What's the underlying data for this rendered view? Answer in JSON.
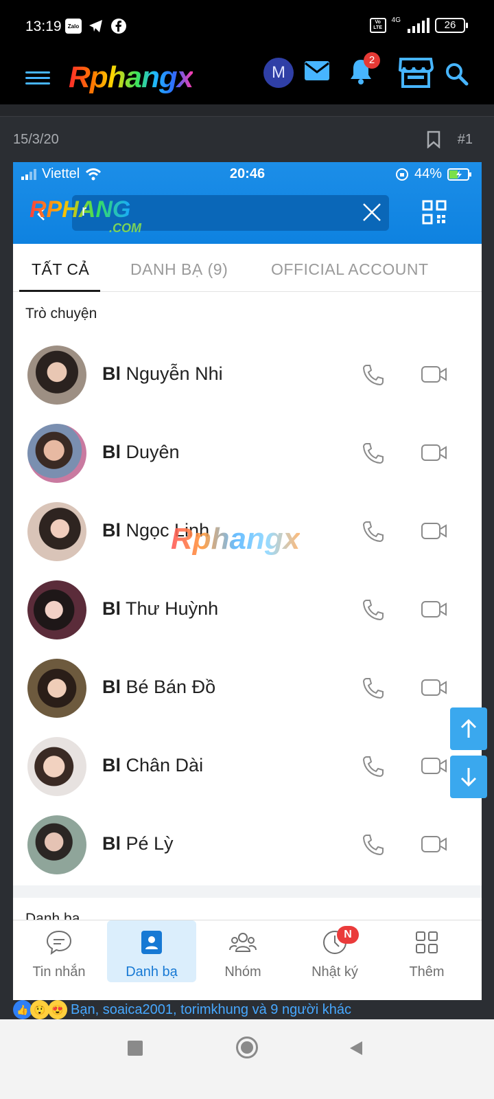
{
  "status_bar": {
    "time": "13:19",
    "zalo_label": "Zalo",
    "volte": "Vo LTE",
    "network": "4G",
    "battery": "26"
  },
  "app_bar": {
    "logo": "Rphangx",
    "avatar_letter": "M",
    "notification_count": "2"
  },
  "post": {
    "date": "15/3/20",
    "post_number": "#1"
  },
  "screenshot": {
    "status": {
      "carrier": "Viettel",
      "time": "20:46",
      "battery": "44%"
    },
    "search": {
      "watermark": "RPHANG",
      "watermark_sub": ".COM",
      "query": "r"
    },
    "tabs": [
      {
        "label": "TẤT CẢ",
        "active": true
      },
      {
        "label": "DANH BẠ (9)",
        "active": false
      },
      {
        "label": "OFFICIAL ACCOUNT",
        "active": false
      }
    ],
    "section_title": "Trò chuyện",
    "contacts": [
      {
        "prefix": "Bl",
        "name": " Nguyễn Nhi"
      },
      {
        "prefix": "Bl",
        "name": " Duyên"
      },
      {
        "prefix": "Bl",
        "name": " Ngọc Linh"
      },
      {
        "prefix": "Bl",
        "name": " Thư Huỳnh"
      },
      {
        "prefix": "Bl",
        "name": " Bé Bán Đồ"
      },
      {
        "prefix": "Bl",
        "name": " Chân Dài"
      },
      {
        "prefix": "Bl",
        "name": " Pé Lỳ"
      }
    ],
    "next_section_peek": "Danh ba",
    "watermark_center": "Rphangx",
    "bottom_nav": [
      {
        "label": "Tin nhắn",
        "active": false
      },
      {
        "label": "Danh bạ",
        "active": true
      },
      {
        "label": "Nhóm",
        "active": false
      },
      {
        "label": "Nhật ký",
        "active": false,
        "badge": "N"
      },
      {
        "label": "Thêm",
        "active": false
      }
    ]
  },
  "reactions": {
    "text": "Bạn, soaica2001, torimkhung và 9 người khác"
  },
  "colors": {
    "accent": "#47b5ff",
    "zalo_blue": "#0e82e0",
    "badge_red": "#ea3b3b"
  }
}
